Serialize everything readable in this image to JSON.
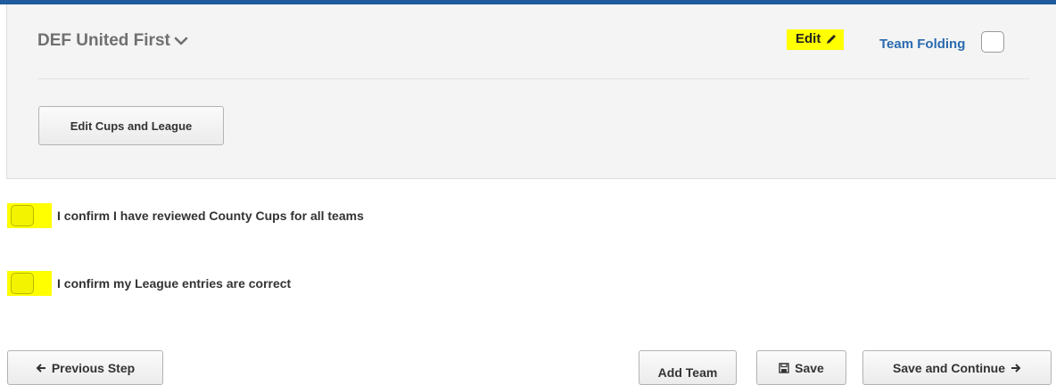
{
  "team_panel": {
    "team_name": "DEF United First",
    "edit_label": "Edit",
    "team_folding_label": "Team Folding",
    "edit_cups_button": "Edit Cups and League"
  },
  "confirmations": [
    {
      "label": "I confirm I have reviewed County Cups for all teams"
    },
    {
      "label": "I confirm my League entries are correct"
    }
  ],
  "footer": {
    "previous_label": "Previous Step",
    "add_team_label": "Add Team",
    "save_label": "Save",
    "save_continue_label": "Save and Continue"
  },
  "colors": {
    "accent": "#1f5c9e",
    "link": "#2a6ab0",
    "highlight": "#ffff00"
  },
  "icons": {
    "team_dropdown": "chevron-down-icon",
    "edit": "pencil-icon",
    "previous": "arrow-left-icon",
    "save": "floppy-disk-icon",
    "continue": "arrow-right-icon"
  }
}
